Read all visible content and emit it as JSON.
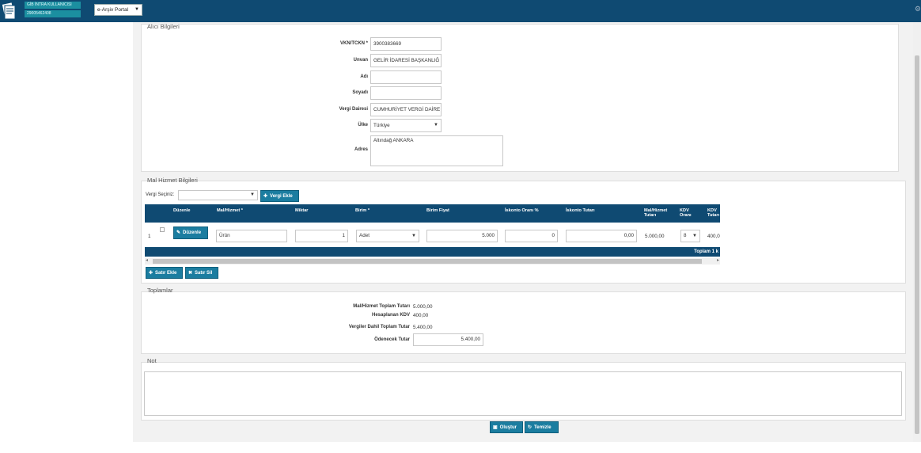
{
  "header": {
    "user_type": "GİB İNTRA KULLANICISI",
    "user_id": "29005462408",
    "portal": "e-Arşiv Portal"
  },
  "alici": {
    "title": "Alıcı Bilgileri",
    "vkn_label": "VKN/TCKN *",
    "vkn_value": "3900383669",
    "unvan_label": "Unvan",
    "unvan_value": "GELİR İDARESİ BAŞKANLIĞ",
    "adi_label": "Adı",
    "adi_value": "",
    "soyadi_label": "Soyadı",
    "soyadi_value": "",
    "vergi_dairesi_label": "Vergi Dairesi",
    "vergi_dairesi_value": "CUMHURİYET VERGİ DAİRE",
    "ulke_label": "Ülke",
    "ulke_value": "Türkiye",
    "adres_label": "Adres",
    "adres_value": "Altındağ ANKARA"
  },
  "mal_hizmet": {
    "title": "Mal Hizmet Bilgileri",
    "vergi_seciniz_label": "Vergi Seçiniz:",
    "vergi_seciniz_value": "",
    "vergi_ekle_label": "Vergi Ekle",
    "columns": [
      "Düzenle",
      "Mal/Hizmet *",
      "Miktar",
      "Birim *",
      "Birim Fiyat",
      "İskonto Oranı %",
      "İskonto Tutarı",
      "Mal/Hizmet Tutarı",
      "KDV Oranı",
      "KDV Tutarı"
    ],
    "row": {
      "index": "1",
      "duzenle_label": "Düzenle",
      "mal_hizmet": "Ürün",
      "miktar": "1",
      "birim": "Adet",
      "birim_fiyat": "5.000",
      "iskonto_orani": "0",
      "iskonto_tutari": "0,00",
      "mal_hizmet_tutari": "5.000,00",
      "kdv_orani": "8",
      "kdv_tutari": "400,0"
    },
    "footer_text": "Toplam 1 k",
    "satir_ekle_label": "Satır Ekle",
    "satir_sil_label": "Satır Sil"
  },
  "toplamlar": {
    "title": "Toplamlar",
    "mal_hizmet_toplam_label": "Mal/Hizmet Toplam Tutarı",
    "mal_hizmet_toplam_value": "5.000,00",
    "hesaplanan_kdv_label": "Hesaplanan KDV",
    "hesaplanan_kdv_value": "400,00",
    "vergiler_dahil_label": "Vergiler Dahil Toplam Tutar",
    "vergiler_dahil_value": "5.400,00",
    "odenecek_label": "Ödenecek Tutar",
    "odenecek_value": "5.400,00"
  },
  "not": {
    "title": "Not",
    "value": ""
  },
  "actions": {
    "olustur_label": "Oluştur",
    "temizle_label": "Temizle"
  },
  "colors": {
    "header_bg": "#0f4a72",
    "accent": "#1b7da0",
    "badge": "#1b8fa0"
  }
}
